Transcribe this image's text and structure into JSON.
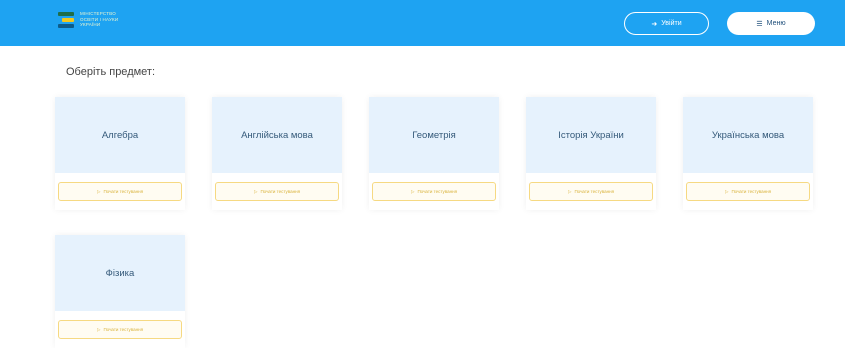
{
  "header": {
    "logo_lines": [
      "Міністерство",
      "Освіти і Науки",
      "України"
    ],
    "signin_label": "Увійти",
    "signin_icon": "arrow-right-icon",
    "menu_label": "Меню",
    "menu_icon": "hamburger-icon",
    "bg_color": "#1ea3f2"
  },
  "main": {
    "heading": "Оберіть предмет:",
    "subjects": [
      {
        "name": "Алгебра",
        "button": "Почати тестування"
      },
      {
        "name": "Англійська мова",
        "button": "Почати тестування"
      },
      {
        "name": "Геометрія",
        "button": "Почати тестування"
      },
      {
        "name": "Історія України",
        "button": "Почати тестування"
      },
      {
        "name": "Українська мова",
        "button": "Почати тестування"
      },
      {
        "name": "Фізика",
        "button": "Почати тестування"
      }
    ]
  }
}
